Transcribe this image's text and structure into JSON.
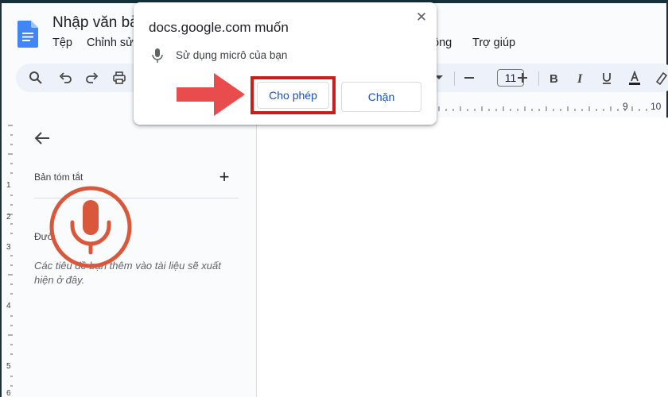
{
  "window": {
    "title": "Nhập văn bả"
  },
  "menu": {
    "items": [
      "Tệp",
      "Chỉnh sử",
      "ộng",
      "Trợ giúp"
    ]
  },
  "toolbar": {
    "font_size": "11",
    "icons": [
      "search-icon",
      "undo-icon",
      "redo-icon",
      "print-icon",
      "dropdown-caret-icon",
      "minus-icon",
      "plus-icon",
      "bold-icon",
      "italic-icon",
      "underline-icon",
      "text-color-icon",
      "highlighter-icon"
    ],
    "text_color_accent": "#202124"
  },
  "ruler": {
    "top_labels": [
      "9",
      "10"
    ],
    "left_labels": [
      "1",
      "2",
      "3",
      "4",
      "5",
      "6"
    ]
  },
  "sidebar": {
    "summary_label": "Bản tóm tắt",
    "add_label": "+",
    "outline_label": "Đườ",
    "outline_placeholder": "Các tiêu đề bạn thêm vào tài liệu sẽ xuất hiện ở đây."
  },
  "dialog": {
    "title": "docs.google.com muốn",
    "close_label": "✕",
    "permission_text": "Sử dụng micrô của bạn",
    "allow_label": "Cho phép",
    "block_label": "Chặn"
  },
  "overlay": {
    "mic_color": "#d9583c",
    "arrow_color": "#e84c4c",
    "highlight_color": "#c81e1e"
  }
}
